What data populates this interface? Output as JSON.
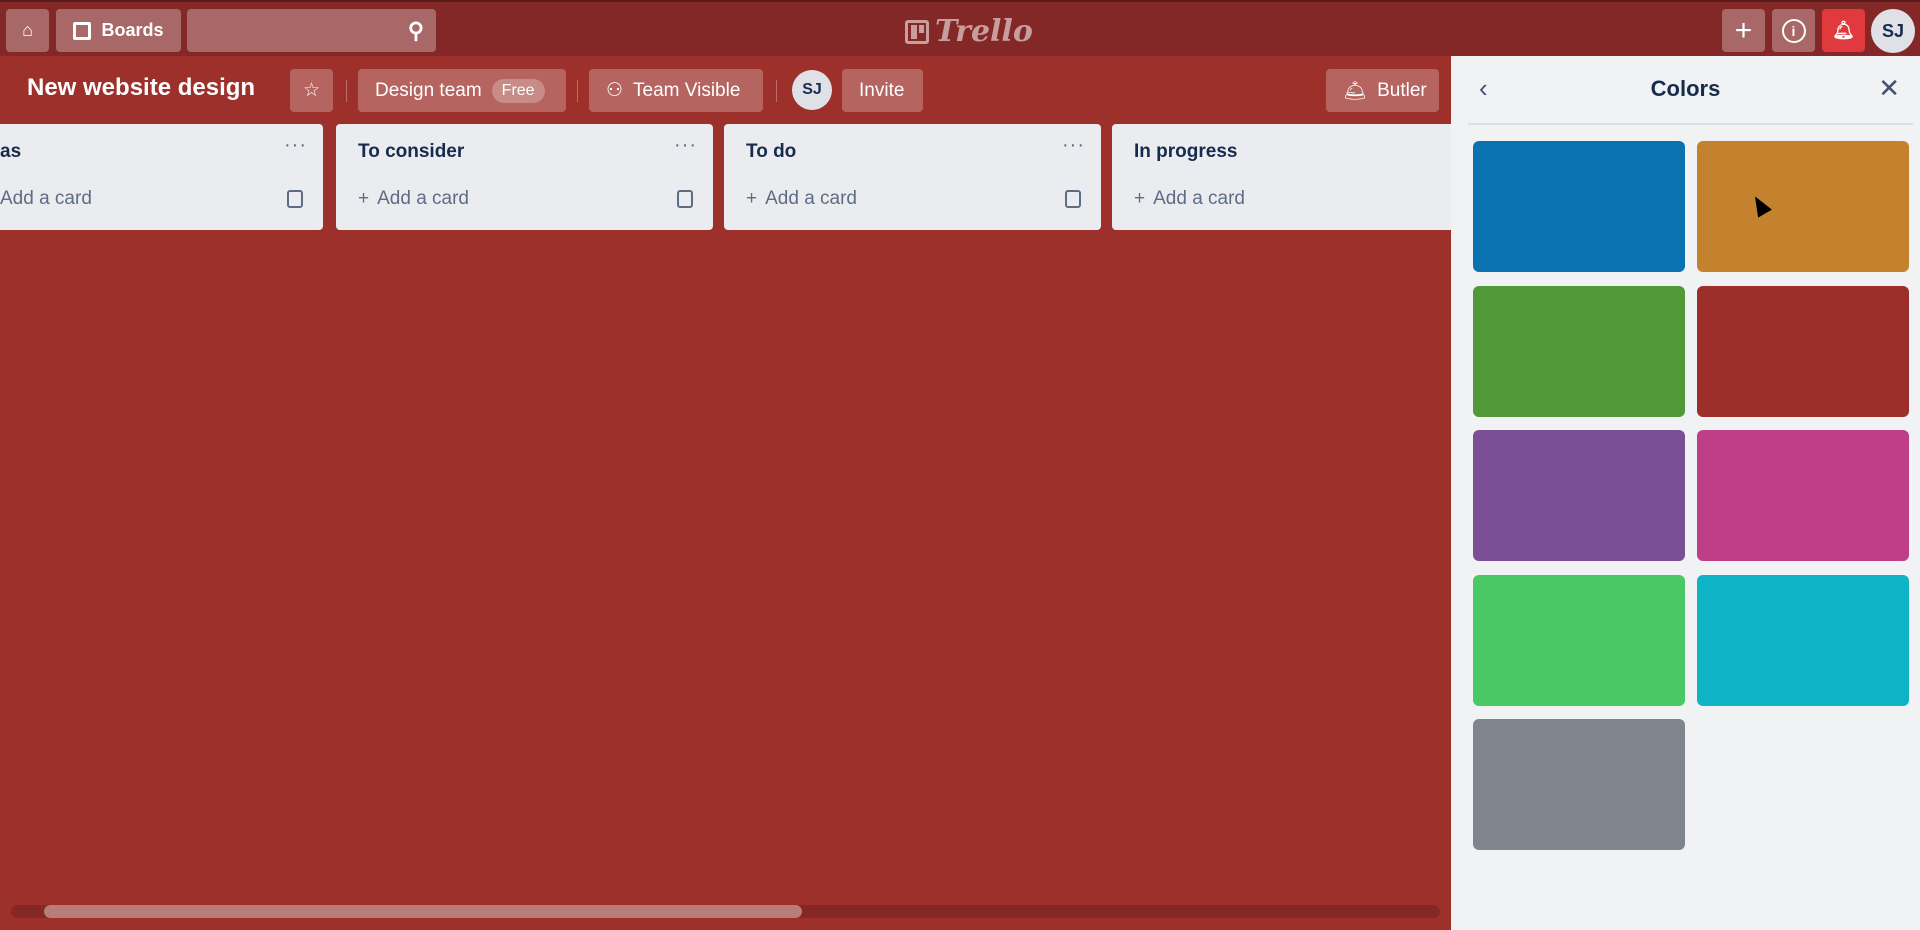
{
  "topbar": {
    "boards_label": "Boards",
    "search_placeholder": "",
    "logo": "Trello",
    "avatar_initials": "SJ"
  },
  "board": {
    "title": "New website design",
    "team": "Design team",
    "team_badge": "Free",
    "visibility": "Team Visible",
    "member_initials": "SJ",
    "invite_label": "Invite",
    "butler_label": "Butler"
  },
  "lists": [
    {
      "name": "as",
      "add_label": "Add a card"
    },
    {
      "name": "To consider",
      "add_label": "Add a card"
    },
    {
      "name": "To do",
      "add_label": "Add a card"
    },
    {
      "name": "In progress",
      "add_label": "Add a card"
    }
  ],
  "panel": {
    "title": "Colors",
    "back_icon": "chevron-left-icon",
    "close_icon": "close-icon",
    "colors": [
      "#0b72b2",
      "#c4822f",
      "#519839",
      "#9d2f2a",
      "#7a4f93",
      "#be3f88",
      "#4bc866",
      "#0fb3c6",
      "#7f858c"
    ]
  },
  "theme": {
    "topbar": "#832826",
    "board_bg": "#9d302b",
    "notification": "#e0393e"
  }
}
